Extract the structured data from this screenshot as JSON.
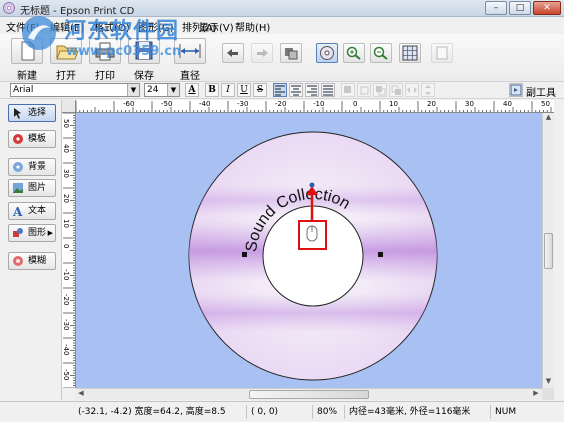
{
  "window": {
    "title": "无标题 - Epson Print CD",
    "controls": {
      "minimize": "–",
      "maximize": "□",
      "close": "✕"
    }
  },
  "menu": {
    "items": [
      "文件(F)",
      "编辑(E)",
      "格式(O)",
      "图形(G)",
      "排列(A)",
      "显示(V)",
      "帮助(H)"
    ]
  },
  "toolbar": {
    "buttons": [
      {
        "label": "新建",
        "icon": "new-document-icon"
      },
      {
        "label": "打开",
        "icon": "open-folder-icon"
      },
      {
        "label": "打印",
        "icon": "printer-icon"
      },
      {
        "label": "保存",
        "icon": "save-disk-icon"
      },
      {
        "label": "直径",
        "icon": "diameter-icon"
      }
    ],
    "small_buttons": [
      {
        "icon": "undo-icon"
      },
      {
        "icon": "redo-icon"
      },
      {
        "icon": "layers-icon"
      },
      {
        "icon": "cd-fit-icon",
        "selected": true
      },
      {
        "icon": "zoom-in-icon"
      },
      {
        "icon": "zoom-out-icon"
      },
      {
        "icon": "grid-icon"
      },
      {
        "icon": "page-icon"
      }
    ]
  },
  "format": {
    "font": "Arial",
    "size": "24",
    "underline_a": "A",
    "bold": "B",
    "italic": "I",
    "underline": "U",
    "strike": "S",
    "side_tools_label": "副工具"
  },
  "left_panel": {
    "items": [
      {
        "label": "选择",
        "icon": "select-arrow-icon",
        "selected": true
      },
      {
        "label": "模板",
        "icon": "template-icon"
      },
      {
        "label": "背景",
        "icon": "background-icon"
      },
      {
        "label": "图片",
        "icon": "picture-icon"
      },
      {
        "label": "文本",
        "icon": "text-icon"
      },
      {
        "label": "图形",
        "icon": "shape-icon",
        "has_submenu": true
      },
      {
        "label": "模糊",
        "icon": "blur-icon"
      }
    ]
  },
  "rulers": {
    "horizontal": [
      "-60",
      "-50",
      "-40",
      "-30",
      "-20",
      "-10",
      "0",
      "10",
      "20",
      "30",
      "40",
      "50",
      "60"
    ],
    "vertical": [
      "50",
      "40",
      "30",
      "20",
      "10",
      "0",
      "-10",
      "-20",
      "-30",
      "-40",
      "-50"
    ]
  },
  "canvas": {
    "curved_text": "Sound Collection",
    "background_color": "#a9c1f2",
    "disc_colors": [
      "#f1e8f6",
      "#c89be0",
      "#ffffff"
    ]
  },
  "status": {
    "selection": "(-32.1, -4.2) 宽度=64.2, 高度=8.5",
    "cursor": "(    0,    0)",
    "zoom": "80%",
    "diameters": "内径=43毫米, 外径=116毫米",
    "num": "NUM"
  },
  "watermark": {
    "site_name": "河东软件园",
    "site_url": "www.pc0359.cn"
  }
}
